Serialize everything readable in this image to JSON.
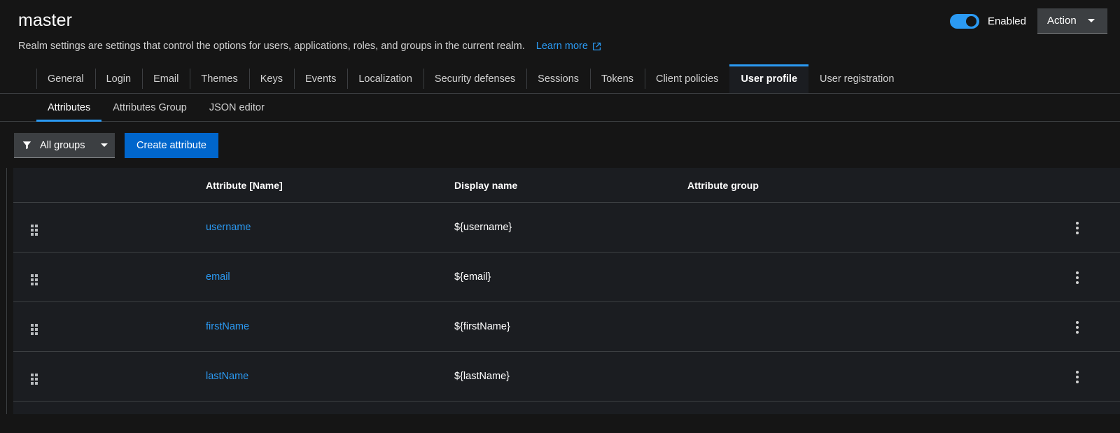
{
  "header": {
    "realm_title": "master",
    "description": "Realm settings are settings that control the options for users, applications, roles, and groups in the current realm.",
    "learn_more_label": "Learn more",
    "learn_more_icon": "external-link-icon",
    "toggle_label": "Enabled",
    "toggle_state": "on",
    "action_button_label": "Action",
    "accent_color": "#2b9af3",
    "primary_button_color": "#0066cc"
  },
  "primary_tabs": [
    {
      "label": "General",
      "active": false
    },
    {
      "label": "Login",
      "active": false
    },
    {
      "label": "Email",
      "active": false
    },
    {
      "label": "Themes",
      "active": false
    },
    {
      "label": "Keys",
      "active": false
    },
    {
      "label": "Events",
      "active": false
    },
    {
      "label": "Localization",
      "active": false
    },
    {
      "label": "Security defenses",
      "active": false
    },
    {
      "label": "Sessions",
      "active": false
    },
    {
      "label": "Tokens",
      "active": false
    },
    {
      "label": "Client policies",
      "active": false
    },
    {
      "label": "User profile",
      "active": true
    },
    {
      "label": "User registration",
      "active": false
    }
  ],
  "secondary_tabs": [
    {
      "label": "Attributes",
      "active": true
    },
    {
      "label": "Attributes Group",
      "active": false
    },
    {
      "label": "JSON editor",
      "active": false
    }
  ],
  "toolbar": {
    "filter_icon": "funnel-icon",
    "filter_label": "All groups",
    "create_label": "Create attribute"
  },
  "table": {
    "columns": [
      "",
      "Attribute [Name]",
      "Display name",
      "Attribute group",
      ""
    ],
    "rows": [
      {
        "name": "username",
        "display_name": "${username}",
        "attribute_group": ""
      },
      {
        "name": "email",
        "display_name": "${email}",
        "attribute_group": ""
      },
      {
        "name": "firstName",
        "display_name": "${firstName}",
        "attribute_group": ""
      },
      {
        "name": "lastName",
        "display_name": "${lastName}",
        "attribute_group": ""
      }
    ]
  }
}
